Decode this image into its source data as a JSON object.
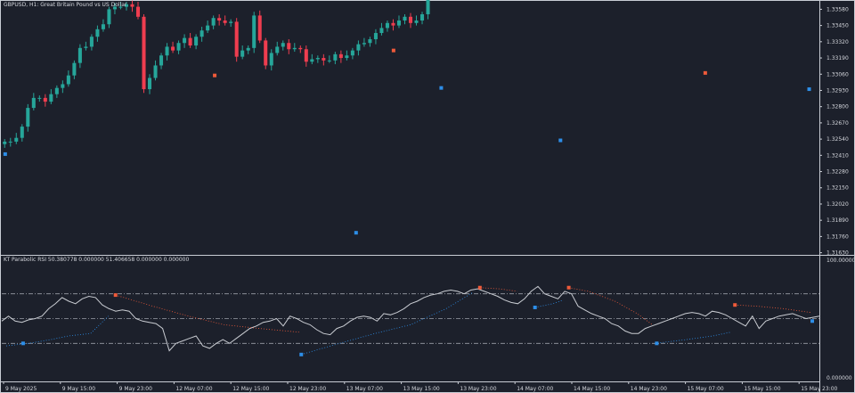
{
  "header": {
    "symbol_line": "GBPUSD, H1:  Great Britain Pound vs US Dollar",
    "indicator_line": "KT Parabolic RSI 50.380778 0.000000 51.406658 0.000000 0.000000"
  },
  "colors": {
    "background": "#1c202b",
    "frame": "#c8ccd4",
    "text": "#d4d6dc",
    "bull": "#26a69a",
    "bear": "#ef3d4f",
    "sar_bull": "#2d8ee8",
    "sar_bear": "#ef5a3a",
    "rsi_line": "#c9ccd2",
    "level_lines": "#9a9ea8"
  },
  "chart_data": [
    {
      "type": "candlestick",
      "title": "GBPUSD, H1:  Great Britain Pound vs US Dollar",
      "y_ticks": [
        "1.33580",
        "1.33450",
        "1.33320",
        "1.33190",
        "1.33060",
        "1.32930",
        "1.32800",
        "1.32670",
        "1.32540",
        "1.32410",
        "1.32280",
        "1.32150",
        "1.32020",
        "1.31890",
        "1.31760",
        "1.31630"
      ],
      "ylim": [
        1.3162,
        1.3364
      ],
      "start_open": 1.325,
      "changes": [
        0.0002,
        0.0,
        0.0003,
        0.0009,
        0.0015,
        0.0008,
        0.0,
        -0.0003,
        0.0006,
        0.0005,
        0.0003,
        0.0007,
        0.001,
        0.0012,
        0.0001,
        0.0008,
        0.0006,
        0.0004,
        0.0012,
        0.0002,
        0.0,
        0.0002,
        -0.0002,
        -0.0008,
        -0.0058,
        0.0009,
        0.001,
        0.0008,
        0.0007,
        -0.0003,
        0.0006,
        0.0004,
        -0.0006,
        0.0007,
        0.0005,
        0.0004,
        0.0006,
        -0.0002,
        -0.0002,
        0.0001,
        -0.0028,
        0.0005,
        0.0002,
        0.0026,
        -0.002,
        -0.002,
        0.001,
        0.0005,
        0.0003,
        -0.0005,
        0.0001,
        -0.0001,
        -0.001,
        0.0002,
        0.0001,
        -0.0002,
        0.0,
        0.0005,
        -0.0003,
        0.0002,
        0.0004,
        0.0005,
        0.0001,
        0.0003,
        0.0005,
        0.0004,
        0.0004,
        -0.0002,
        0.0004,
        0.0003,
        -0.0005,
        0.0002,
        0.0005,
        0.0015,
        0.001,
        0.0007,
        0.0015,
        0.0012,
        0.001,
        0.001,
        0.0008,
        0.0004,
        0.0002,
        0.0001,
        0.0002,
        0.0,
        0.0003,
        -0.0001,
        0.0003,
        -0.0001,
        0.0,
        -0.0005,
        0.0,
        0.0001,
        -0.0002,
        -0.0001,
        -0.0004,
        0.0,
        0.0018,
        0.001,
        0.0006,
        -0.0005,
        -0.0007,
        -0.0008,
        -0.0007,
        -0.0005,
        -0.0006,
        -0.0006,
        -0.0007,
        -0.0004,
        -0.0002,
        -0.0003,
        0.0003,
        0.0002,
        0.0003,
        0.0004,
        0.0002,
        0.0001,
        0.0003,
        -0.0001,
        0.0002,
        -0.0001,
        -0.0002,
        0.0015,
        -0.002,
        0.0012,
        0.0003,
        0.0004,
        0.0004,
        -0.0013,
        0.0016,
        -0.0004,
        -0.0006,
        0.0008,
        0.0002,
        0.0004,
        0.0001,
        0.0002,
        -0.0003,
        0.0003,
        -0.0002
      ],
      "sar_dots": [
        {
          "i": 2,
          "y": 1.3242,
          "dir": "bull"
        },
        {
          "i": 125,
          "y": 1.3305,
          "dir": "bear"
        },
        {
          "i": 208,
          "y": 1.3179,
          "dir": "bull"
        },
        {
          "i": 230,
          "y": 1.3325,
          "dir": "bear"
        },
        {
          "i": 258,
          "y": 1.3295,
          "dir": "bull"
        },
        {
          "i": 328,
          "y": 1.3253,
          "dir": "bull"
        },
        {
          "i": 413,
          "y": 1.3307,
          "dir": "bear"
        },
        {
          "i": 474,
          "y": 1.3294,
          "dir": "bull"
        }
      ]
    },
    {
      "type": "line",
      "title": "KT Parabolic RSI 50.380778 0.000000 51.406658 0.000000 0.000000",
      "y_ticks": [
        "100.000000",
        "0.000000"
      ],
      "ylim": [
        0,
        100
      ],
      "levels": [
        70,
        50,
        30
      ],
      "rsi": [
        48,
        52,
        48,
        47,
        49,
        50,
        52,
        58,
        62,
        67,
        64,
        62,
        66,
        68,
        67,
        61,
        58,
        56,
        57,
        56,
        50,
        48,
        47,
        46,
        42,
        24,
        30,
        32,
        34,
        36,
        28,
        26,
        30,
        33,
        30,
        34,
        38,
        42,
        44,
        47,
        48,
        50,
        44,
        52,
        50,
        47,
        45,
        41,
        38,
        37,
        42,
        44,
        48,
        51,
        52,
        51,
        48,
        54,
        53,
        55,
        58,
        62,
        64,
        67,
        69,
        70,
        72,
        73,
        72,
        70,
        73,
        74,
        72,
        70,
        68,
        65,
        63,
        62,
        66,
        72,
        76,
        70,
        68,
        66,
        72,
        70,
        60,
        57,
        54,
        52,
        50,
        46,
        44,
        40,
        38,
        38,
        42,
        44,
        46,
        48,
        50,
        52,
        54,
        55,
        54,
        52,
        56,
        55,
        53,
        50,
        47,
        44,
        52,
        42,
        48,
        50,
        52,
        53,
        54,
        52,
        50,
        51,
        52
      ],
      "sar_lines": [
        {
          "points": [
            [
              5,
              28
            ],
            [
              30,
              30
            ],
            [
              55,
              33
            ],
            [
              75,
              36
            ],
            [
              100,
              38
            ],
            [
              120,
              52
            ]
          ],
          "dir": "bull"
        },
        {
          "points": [
            [
              128,
              69
            ],
            [
              170,
              60
            ],
            [
              210,
              52
            ],
            [
              250,
              45
            ],
            [
              290,
              42
            ],
            [
              320,
              40
            ],
            [
              335,
              39
            ]
          ],
          "dir": "bear"
        },
        {
          "points": [
            [
              337,
              21
            ],
            [
              380,
              30
            ],
            [
              420,
              38
            ],
            [
              460,
              45
            ],
            [
              500,
              58
            ],
            [
              530,
              71
            ]
          ],
          "dir": "bull"
        },
        {
          "points": [
            [
              538,
              75
            ],
            [
              560,
              74
            ],
            [
              580,
              72
            ]
          ],
          "dir": "bear"
        },
        {
          "points": [
            [
              600,
              59
            ],
            [
              620,
              62
            ],
            [
              632,
              65
            ]
          ],
          "dir": "bull"
        },
        {
          "points": [
            [
              638,
              75
            ],
            [
              660,
              72
            ],
            [
              690,
              64
            ],
            [
              715,
              54
            ],
            [
              732,
              45
            ]
          ],
          "dir": "bear"
        },
        {
          "points": [
            [
              735,
              30
            ],
            [
              770,
              33
            ],
            [
              800,
              36
            ],
            [
              820,
              39
            ]
          ],
          "dir": "bull"
        },
        {
          "points": [
            [
              825,
              61
            ],
            [
              850,
              60
            ],
            [
              880,
              58
            ],
            [
              910,
              55
            ]
          ],
          "dir": "bear"
        }
      ],
      "sar_markers": [
        {
          "x": 24,
          "y": 30,
          "dir": "bull"
        },
        {
          "x": 128,
          "y": 69,
          "dir": "bear"
        },
        {
          "x": 337,
          "y": 21,
          "dir": "bull"
        },
        {
          "x": 538,
          "y": 75,
          "dir": "bear"
        },
        {
          "x": 600,
          "y": 59,
          "dir": "bull"
        },
        {
          "x": 638,
          "y": 75,
          "dir": "bear"
        },
        {
          "x": 737,
          "y": 30,
          "dir": "bull"
        },
        {
          "x": 825,
          "y": 61,
          "dir": "bear"
        },
        {
          "x": 912,
          "y": 48,
          "dir": "bull"
        }
      ]
    }
  ],
  "time_axis": [
    "9 May 2025",
    "9 May 15:00",
    "9 May 23:00",
    "12 May 07:00",
    "12 May 15:00",
    "12 May 23:00",
    "13 May 07:00",
    "13 May 15:00",
    "13 May 23:00",
    "14 May 07:00",
    "14 May 15:00",
    "14 May 23:00",
    "15 May 07:00",
    "15 May 15:00",
    "15 May 23:00"
  ]
}
